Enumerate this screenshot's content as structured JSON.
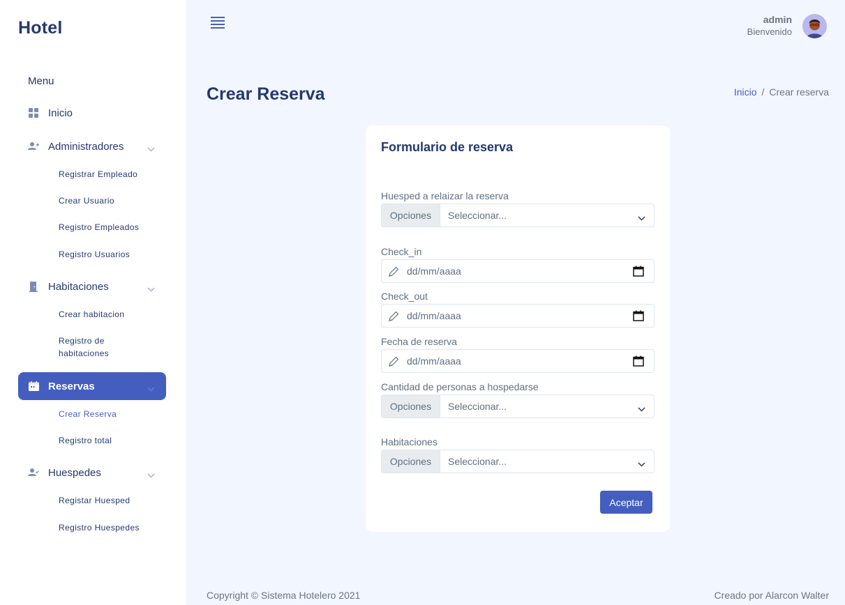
{
  "sidebar": {
    "brand": "Hotel",
    "menu_title": "Menu",
    "items": [
      {
        "label": "Inicio",
        "icon": "grid-icon"
      },
      {
        "label": "Administradores",
        "icon": "user-plus-icon",
        "sub": [
          "Registrar Empleado",
          "Crear Usuario",
          "Registro Empleados",
          "Registro Usuarios"
        ]
      },
      {
        "label": "Habitaciones",
        "icon": "door-icon",
        "sub": [
          "Crear habitacion",
          "Registro de habitaciones"
        ]
      },
      {
        "label": "Reservas",
        "icon": "calendar-icon",
        "active": true,
        "sub": [
          "Crear Reserva",
          "Registro total"
        ]
      },
      {
        "label": "Huespedes",
        "icon": "user-check-icon",
        "sub": [
          "Registar Huesped",
          "Registro Huespedes"
        ]
      }
    ]
  },
  "topbar": {
    "user_name": "admin",
    "greeting": "Bienvenido"
  },
  "page": {
    "title": "Crear Reserva",
    "breadcrumb": {
      "home": "Inicio",
      "separator": "/",
      "current": "Crear reserva"
    }
  },
  "form": {
    "title": "Formulario de reserva",
    "guest_label": "Huesped a relaizar la reserva",
    "options_label": "Opciones",
    "select_placeholder": "Seleccionar...",
    "checkin_label": "Check_in",
    "checkout_label": "Check_out",
    "reservation_date_label": "Fecha de reserva",
    "date_placeholder": "dd/mm/aaaa",
    "people_label": "Cantidad de personas a hospedarse",
    "rooms_label": "Habitaciones",
    "submit_label": "Aceptar"
  },
  "footer": {
    "copyright": "Copyright © Sistema Hotelero 2021",
    "credit": "Creado por Alarcon Walter"
  },
  "colors": {
    "primary": "#435ebe",
    "background": "#f2f7ff",
    "text_dark": "#25396f",
    "text_muted": "#607080"
  }
}
